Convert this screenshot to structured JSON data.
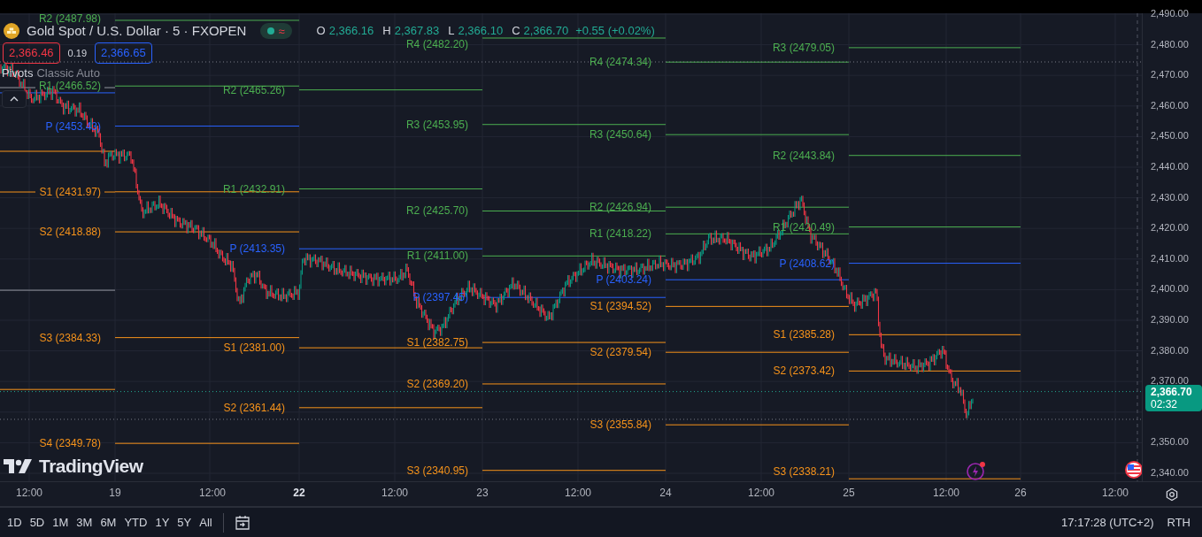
{
  "legend": {
    "title": "Gold Spot / U.S. Dollar · 5 · FXOPEN",
    "status_badge": "≈",
    "ohlc": [
      {
        "key": "O",
        "value": "2,366.16"
      },
      {
        "key": "H",
        "value": "2,367.83"
      },
      {
        "key": "L",
        "value": "2,366.10"
      },
      {
        "key": "C",
        "value": "2,366.70"
      }
    ],
    "change": "+0.55 (+0.02%)",
    "bid": "2,366.46",
    "spread": "0.19",
    "ask": "2,366.65",
    "indicator": {
      "name": "Pivots",
      "params": "Classic Auto"
    }
  },
  "pivot_periods": [
    {
      "levels": [
        {
          "label": "R2 (2487.98)",
          "kind": "resistance"
        },
        {
          "label": "R1 (2466.52)",
          "kind": "resistance"
        },
        {
          "label": "P (2453.43)",
          "kind": "pivot"
        },
        {
          "label": "S1 (2431.97)",
          "kind": "support"
        },
        {
          "label": "S2 (2418.88)",
          "kind": "support"
        },
        {
          "label": "S3 (2384.33)",
          "kind": "support"
        },
        {
          "label": "S4 (2349.78)",
          "kind": "support"
        }
      ]
    },
    {
      "levels": [
        {
          "label": "R2 (2465.26)",
          "kind": "resistance"
        },
        {
          "label": "R1 (2432.91)",
          "kind": "resistance"
        },
        {
          "label": "P (2413.35)",
          "kind": "pivot"
        },
        {
          "label": "S1 (2381.00)",
          "kind": "support"
        },
        {
          "label": "S2 (2361.44)",
          "kind": "support"
        }
      ]
    },
    {
      "levels": [
        {
          "label": "R4 (2482.20)",
          "kind": "resistance"
        },
        {
          "label": "R3 (2453.95)",
          "kind": "resistance"
        },
        {
          "label": "R2 (2425.70)",
          "kind": "resistance"
        },
        {
          "label": "R1 (2411.00)",
          "kind": "resistance"
        },
        {
          "label": "P (2397.45)",
          "kind": "pivot"
        },
        {
          "label": "S1 (2382.75)",
          "kind": "support"
        },
        {
          "label": "S2 (2369.20)",
          "kind": "support"
        },
        {
          "label": "S3 (2340.95)",
          "kind": "support"
        }
      ]
    },
    {
      "levels": [
        {
          "label": "R4 (2474.34)",
          "kind": "resistance"
        },
        {
          "label": "R3 (2450.64)",
          "kind": "resistance"
        },
        {
          "label": "R2 (2426.94)",
          "kind": "resistance"
        },
        {
          "label": "R1 (2418.22)",
          "kind": "resistance"
        },
        {
          "label": "P (2403.24)",
          "kind": "pivot"
        },
        {
          "label": "S1 (2394.52)",
          "kind": "support"
        },
        {
          "label": "S2 (2379.54)",
          "kind": "support"
        },
        {
          "label": "S3 (2355.84)",
          "kind": "support"
        }
      ]
    },
    {
      "levels": [
        {
          "label": "R3 (2479.05)",
          "kind": "resistance"
        },
        {
          "label": "R2 (2443.84)",
          "kind": "resistance"
        },
        {
          "label": "R1 (2420.49)",
          "kind": "resistance"
        },
        {
          "label": "P (2408.62)",
          "kind": "pivot"
        },
        {
          "label": "S1 (2385.28)",
          "kind": "support"
        },
        {
          "label": "S2 (2373.42)",
          "kind": "support"
        },
        {
          "label": "S3 (2338.21)",
          "kind": "support"
        }
      ]
    }
  ],
  "watermark_logo": "TradingView",
  "price_axis": [
    "2,490.00",
    "2,480.00",
    "2,470.00",
    "2,460.00",
    "2,450.00",
    "2,440.00",
    "2,430.00",
    "2,420.00",
    "2,410.00",
    "2,400.00",
    "2,390.00",
    "2,380.00",
    "2,370.00",
    "2,350.00",
    "2,340.00"
  ],
  "current_price": {
    "price": "2,366.70",
    "countdown": "02:32"
  },
  "time_axis": [
    {
      "label": "12:00",
      "bold": false
    },
    {
      "label": "19",
      "bold": false
    },
    {
      "label": "12:00",
      "bold": false
    },
    {
      "label": "22",
      "bold": true
    },
    {
      "label": "12:00",
      "bold": false
    },
    {
      "label": "23",
      "bold": false
    },
    {
      "label": "12:00",
      "bold": false
    },
    {
      "label": "24",
      "bold": false
    },
    {
      "label": "12:00",
      "bold": false
    },
    {
      "label": "25",
      "bold": false
    },
    {
      "label": "12:00",
      "bold": false
    },
    {
      "label": "26",
      "bold": false
    },
    {
      "label": "12:00",
      "bold": false
    }
  ],
  "ranges": [
    "1D",
    "5D",
    "1M",
    "3M",
    "6M",
    "YTD",
    "1Y",
    "5Y",
    "All"
  ],
  "clock": "17:17:28 (UTC+2)",
  "session": "RTH"
}
